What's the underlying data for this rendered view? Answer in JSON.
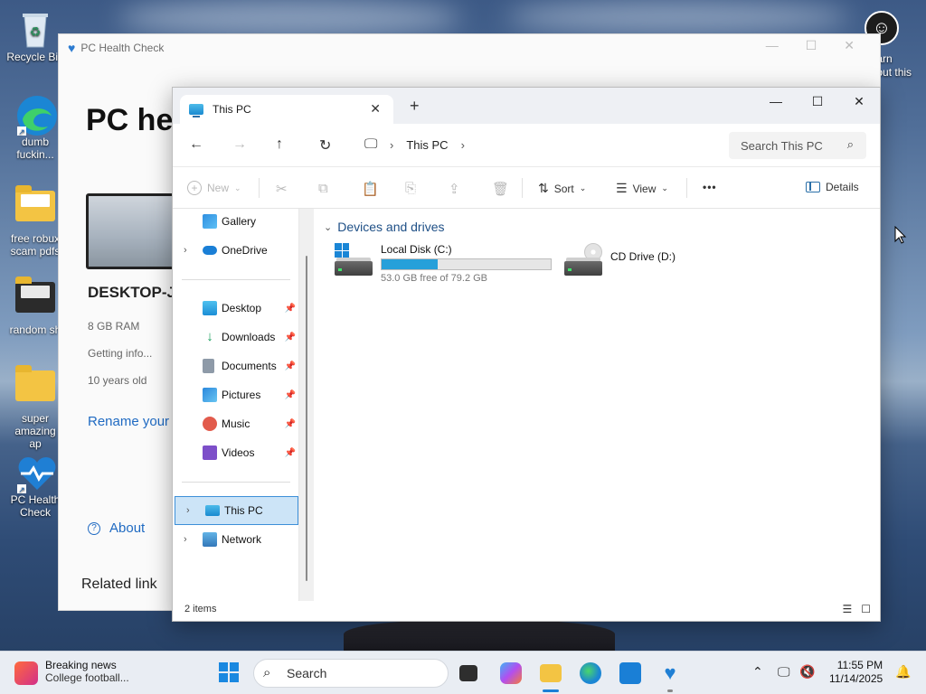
{
  "desktop": {
    "icons": [
      {
        "label": "Recycle Bin",
        "icon": "recycle-bin-icon"
      },
      {
        "label": "dumb fuckin...",
        "icon": "edge-shortcut-icon"
      },
      {
        "label": "free robux scam pdfs",
        "icon": "folder-icon"
      },
      {
        "label": "random sh",
        "icon": "folder-icon"
      },
      {
        "label": "super amazing ap",
        "icon": "folder-icon"
      },
      {
        "label": "PC Health Check",
        "icon": "health-check-icon"
      }
    ],
    "learn_about": "Learn about this picture"
  },
  "pc_health_check": {
    "title": "PC Health Check",
    "heading": "PC hea",
    "device_name": "DESKTOP-JI",
    "ram": "8 GB RAM",
    "storage": "Getting info...",
    "age": "10 years old",
    "rename_link": "Rename your",
    "about_link": "About",
    "related": "Related link"
  },
  "explorer": {
    "tab_title": "This PC",
    "address": {
      "location": "This PC",
      "search_placeholder": "Search This PC"
    },
    "commands": {
      "new": "New",
      "sort": "Sort",
      "view": "View",
      "more": "•••",
      "details": "Details"
    },
    "nav": [
      {
        "label": "Gallery",
        "pinned": false
      },
      {
        "label": "OneDrive",
        "pinned": false,
        "expandable": true
      },
      {
        "label": "Desktop",
        "pinned": true
      },
      {
        "label": "Downloads",
        "pinned": true
      },
      {
        "label": "Documents",
        "pinned": true
      },
      {
        "label": "Pictures",
        "pinned": true
      },
      {
        "label": "Music",
        "pinned": true
      },
      {
        "label": "Videos",
        "pinned": true
      },
      {
        "label": "This PC",
        "selected": true,
        "expandable": true
      },
      {
        "label": "Network",
        "expandable": true
      }
    ],
    "group_title": "Devices and drives",
    "drives": [
      {
        "name": "Local Disk (C:)",
        "free_text": "53.0 GB free of 79.2 GB",
        "used_fraction": 0.33
      },
      {
        "name": "CD Drive (D:)"
      }
    ],
    "status": "2 items"
  },
  "taskbar": {
    "news_title": "Breaking news",
    "news_sub": "College football...",
    "search_placeholder": "Search",
    "time": "11:55 PM",
    "date": "11/14/2025"
  },
  "colors": {
    "accent": "#1a86d6",
    "selected_bg": "#cce4f7",
    "link": "#1f6ac2"
  }
}
